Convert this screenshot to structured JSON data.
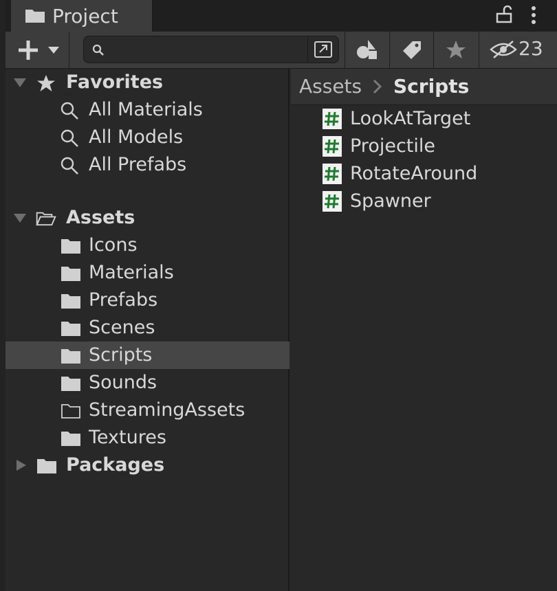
{
  "tab": {
    "title": "Project"
  },
  "toolbar": {
    "search": {
      "value": "",
      "placeholder": ""
    },
    "hidden_packages_count": "23"
  },
  "tree": {
    "favorites": {
      "label": "Favorites",
      "items": [
        "All Materials",
        "All Models",
        "All Prefabs"
      ]
    },
    "assets": {
      "label": "Assets",
      "items": [
        "Icons",
        "Materials",
        "Prefabs",
        "Scenes",
        "Scripts",
        "Sounds",
        "StreamingAssets",
        "Textures"
      ],
      "selected": "Scripts"
    },
    "packages": {
      "label": "Packages"
    }
  },
  "breadcrumb": {
    "root": "Assets",
    "current": "Scripts"
  },
  "files": [
    "LookAtTarget",
    "Projectile",
    "RotateAround",
    "Spawner"
  ],
  "colors": {
    "panel": "#282828",
    "selected_row": "#464646",
    "toolbar": "#3c3c3c",
    "script_icon_hash": "#1e7a2e"
  }
}
